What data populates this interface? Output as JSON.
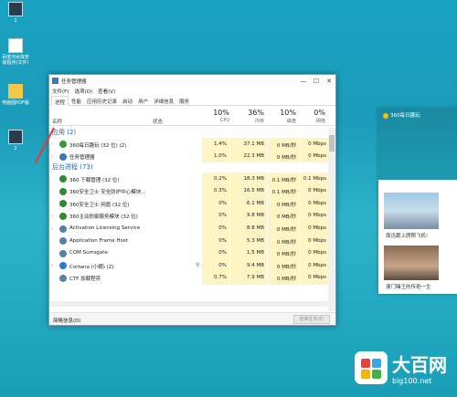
{
  "desktop": {
    "icons": [
      {
        "label": "1"
      },
      {
        "label": "百度河水库安装程序(文件)"
      },
      {
        "label": "电脑图PDF版"
      },
      {
        "label": "2"
      }
    ]
  },
  "window": {
    "title": "任务管理器",
    "controls": [
      "—",
      "☐",
      "✕"
    ],
    "menu": [
      "文件(F)",
      "选项(O)",
      "查看(V)"
    ],
    "tabs": [
      "进程",
      "性能",
      "应用历史记录",
      "启动",
      "用户",
      "详细信息",
      "服务"
    ],
    "active_tab": 0
  },
  "columns": {
    "name": "名称",
    "status": "状态",
    "cpu": {
      "pct": "10%",
      "label": "CPU"
    },
    "memory": {
      "pct": "36%",
      "label": "内存"
    },
    "disk": {
      "pct": "10%",
      "label": "磁盘"
    },
    "network": {
      "pct": "0%",
      "label": "网络"
    }
  },
  "groups": [
    {
      "title": "应用 (2)",
      "rows": [
        {
          "name": "360每日趣玩 (32 位) (2)",
          "cpu": "1.4%",
          "mem": "37.1 MB",
          "disk": "0 MB/秒",
          "net": "0 Mbps",
          "expand": true,
          "icon_color": "#3a9a3a"
        },
        {
          "name": "任务管理器",
          "cpu": "1.0%",
          "mem": "22.3 MB",
          "disk": "0 MB/秒",
          "net": "0 Mbps",
          "expand": true,
          "icon_color": "#3c78b4"
        }
      ]
    },
    {
      "title": "后台进程 (73)",
      "rows": [
        {
          "name": "360 下载管理 (32 位)",
          "cpu": "0.2%",
          "mem": "18.3 MB",
          "disk": "0.1 MB/秒",
          "net": "0.1 Mbps",
          "expand": false,
          "icon_color": "#2e8b2e"
        },
        {
          "name": "360安全卫士 安全防护中心模块...",
          "cpu": "0.3%",
          "mem": "16.5 MB",
          "disk": "0.1 MB/秒",
          "net": "0 Mbps",
          "expand": false,
          "icon_color": "#2e8b2e"
        },
        {
          "name": "360安全卫士 网盾 (32 位)",
          "cpu": "0%",
          "mem": "6.1 MB",
          "disk": "0 MB/秒",
          "net": "0 Mbps",
          "expand": false,
          "icon_color": "#2e8b2e"
        },
        {
          "name": "360主动防御服务模块 (32 位)",
          "cpu": "0%",
          "mem": "9.8 MB",
          "disk": "0 MB/秒",
          "net": "0 Mbps",
          "expand": true,
          "icon_color": "#2e8b2e"
        },
        {
          "name": "Activation Licensing Service",
          "cpu": "0%",
          "mem": "8.8 MB",
          "disk": "0 MB/秒",
          "net": "0 Mbps",
          "expand": true,
          "icon_color": "#5a7fa8"
        },
        {
          "name": "Application Frame Host",
          "cpu": "0%",
          "mem": "5.3 MB",
          "disk": "0 MB/秒",
          "net": "0 Mbps",
          "expand": false,
          "icon_color": "#5a7fa8"
        },
        {
          "name": "COM Surrogate",
          "cpu": "0%",
          "mem": "1.5 MB",
          "disk": "0 MB/秒",
          "net": "0 Mbps",
          "expand": false,
          "icon_color": "#5a7fa8"
        },
        {
          "name": "Cortana (小娜) (2)",
          "cpu": "0%",
          "mem": "9.4 MB",
          "disk": "0 MB/秒",
          "net": "0 Mbps",
          "expand": true,
          "icon_color": "#2b79d0",
          "leaf": true
        },
        {
          "name": "CTF 加载程序",
          "cpu": "0.7%",
          "mem": "7.9 MB",
          "disk": "0 MB/秒",
          "net": "0 Mbps",
          "expand": false,
          "icon_color": "#5a7fa8"
        }
      ]
    }
  ],
  "footer": {
    "less_details": "简略信息(D)",
    "end_task": "结束任务(E)"
  },
  "news": {
    "title": "360每日趣玩",
    "captions": [
      "周迅跟上牌照飞机!",
      "澳门赌王的传奇一生"
    ]
  },
  "watermark": {
    "title": "大百网",
    "url": "big100.net"
  }
}
